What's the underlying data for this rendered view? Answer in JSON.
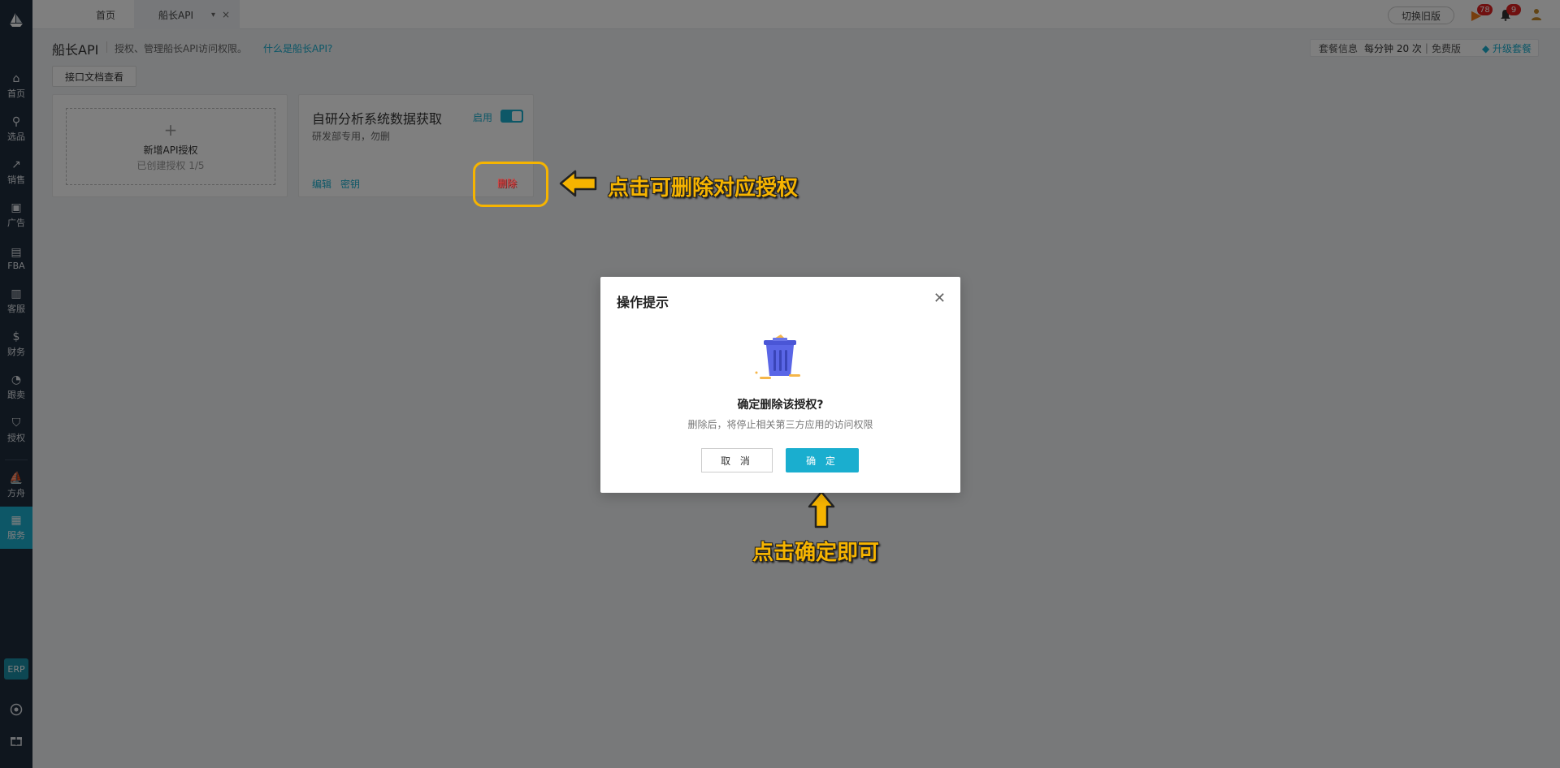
{
  "sidebar": {
    "items": [
      {
        "label": "首页",
        "icon": "home-icon",
        "glyph": "⌂"
      },
      {
        "label": "选品",
        "icon": "search-icon",
        "glyph": "⚲"
      },
      {
        "label": "销售",
        "icon": "trend-icon",
        "glyph": "↗"
      },
      {
        "label": "广告",
        "icon": "ad-icon",
        "glyph": "▣"
      },
      {
        "label": "FBA",
        "icon": "warehouse-icon",
        "glyph": "▤"
      },
      {
        "label": "客服",
        "icon": "chart-icon",
        "glyph": "▥"
      },
      {
        "label": "财务",
        "icon": "dollar-icon",
        "glyph": "$"
      },
      {
        "label": "跟卖",
        "icon": "pie-icon",
        "glyph": "◔"
      },
      {
        "label": "授权",
        "icon": "shield-icon",
        "glyph": "⛉"
      },
      {
        "label": "方舟",
        "icon": "ark-icon",
        "glyph": "⛵"
      },
      {
        "label": "服务",
        "icon": "service-icon",
        "glyph": "▦"
      }
    ],
    "erp_label": "ERP"
  },
  "topbar": {
    "home_tab": "首页",
    "api_tab": "船长API",
    "switch_old": "切换旧版",
    "flag_count": "78",
    "bell_count": "9"
  },
  "page": {
    "title": "船长API",
    "desc": "授权、管理船长API访问权限。",
    "link": "什么是船长API?",
    "doc_button": "接口文档查看",
    "plan_label": "套餐信息",
    "plan_rate": "每分钟 20 次",
    "plan_type": "免费版",
    "upgrade": "升级套餐"
  },
  "add_card": {
    "plus": "+",
    "title": "新增API授权",
    "sub": "已创建授权 1/5"
  },
  "auth_card": {
    "title": "自研分析系统数据获取",
    "enable": "启用",
    "desc": "研发部专用，勿删",
    "edit": "编辑",
    "key": "密钥",
    "delete": "删除"
  },
  "dialog": {
    "title": "操作提示",
    "question": "确定删除该授权?",
    "note": "删除后，将停止相关第三方应用的访问权限",
    "cancel": "取 消",
    "ok": "确 定"
  },
  "annotations": {
    "delete_hint": "点击可删除对应授权",
    "confirm_hint": "点击确定即可",
    "color": "#f6b400"
  }
}
